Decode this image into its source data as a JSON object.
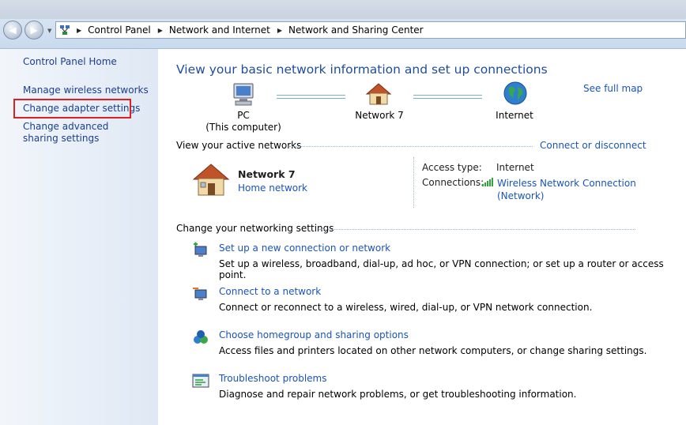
{
  "address": {
    "crumbs": [
      "Control Panel",
      "Network and Internet",
      "Network and Sharing Center"
    ]
  },
  "sidebar": {
    "home": "Control Panel Home",
    "items": [
      {
        "label": "Manage wireless networks"
      },
      {
        "label": "Change adapter settings"
      },
      {
        "label": "Change advanced sharing settings"
      }
    ]
  },
  "main": {
    "heading": "View your basic network information and set up connections",
    "see_full_map": "See full map",
    "map": {
      "pc_label": "PC",
      "pc_sublabel": "(This computer)",
      "network_label": "Network  7",
      "internet_label": "Internet"
    },
    "active": {
      "title": "View your active networks",
      "connect_link": "Connect or disconnect",
      "network_name": "Network  7",
      "network_type": "Home network",
      "access_type_label": "Access type:",
      "access_type_value": "Internet",
      "connections_label": "Connections:",
      "connection_name": "Wireless Network Connection",
      "connection_sub": "(Network)"
    },
    "settings": {
      "title": "Change your networking settings",
      "tasks": [
        {
          "title": "Set up a new connection or network",
          "desc": "Set up a wireless, broadband, dial-up, ad hoc, or VPN connection; or set up a router or access point."
        },
        {
          "title": "Connect to a network",
          "desc": "Connect or reconnect to a wireless, wired, dial-up, or VPN network connection."
        },
        {
          "title": "Choose homegroup and sharing options",
          "desc": "Access files and printers located on other network computers, or change sharing settings."
        },
        {
          "title": "Troubleshoot problems",
          "desc": "Diagnose and repair network problems, or get troubleshooting information."
        }
      ]
    }
  },
  "colors": {
    "link": "#1a54b8",
    "heading": "#1e4d9c",
    "highlight": "#e02020"
  }
}
